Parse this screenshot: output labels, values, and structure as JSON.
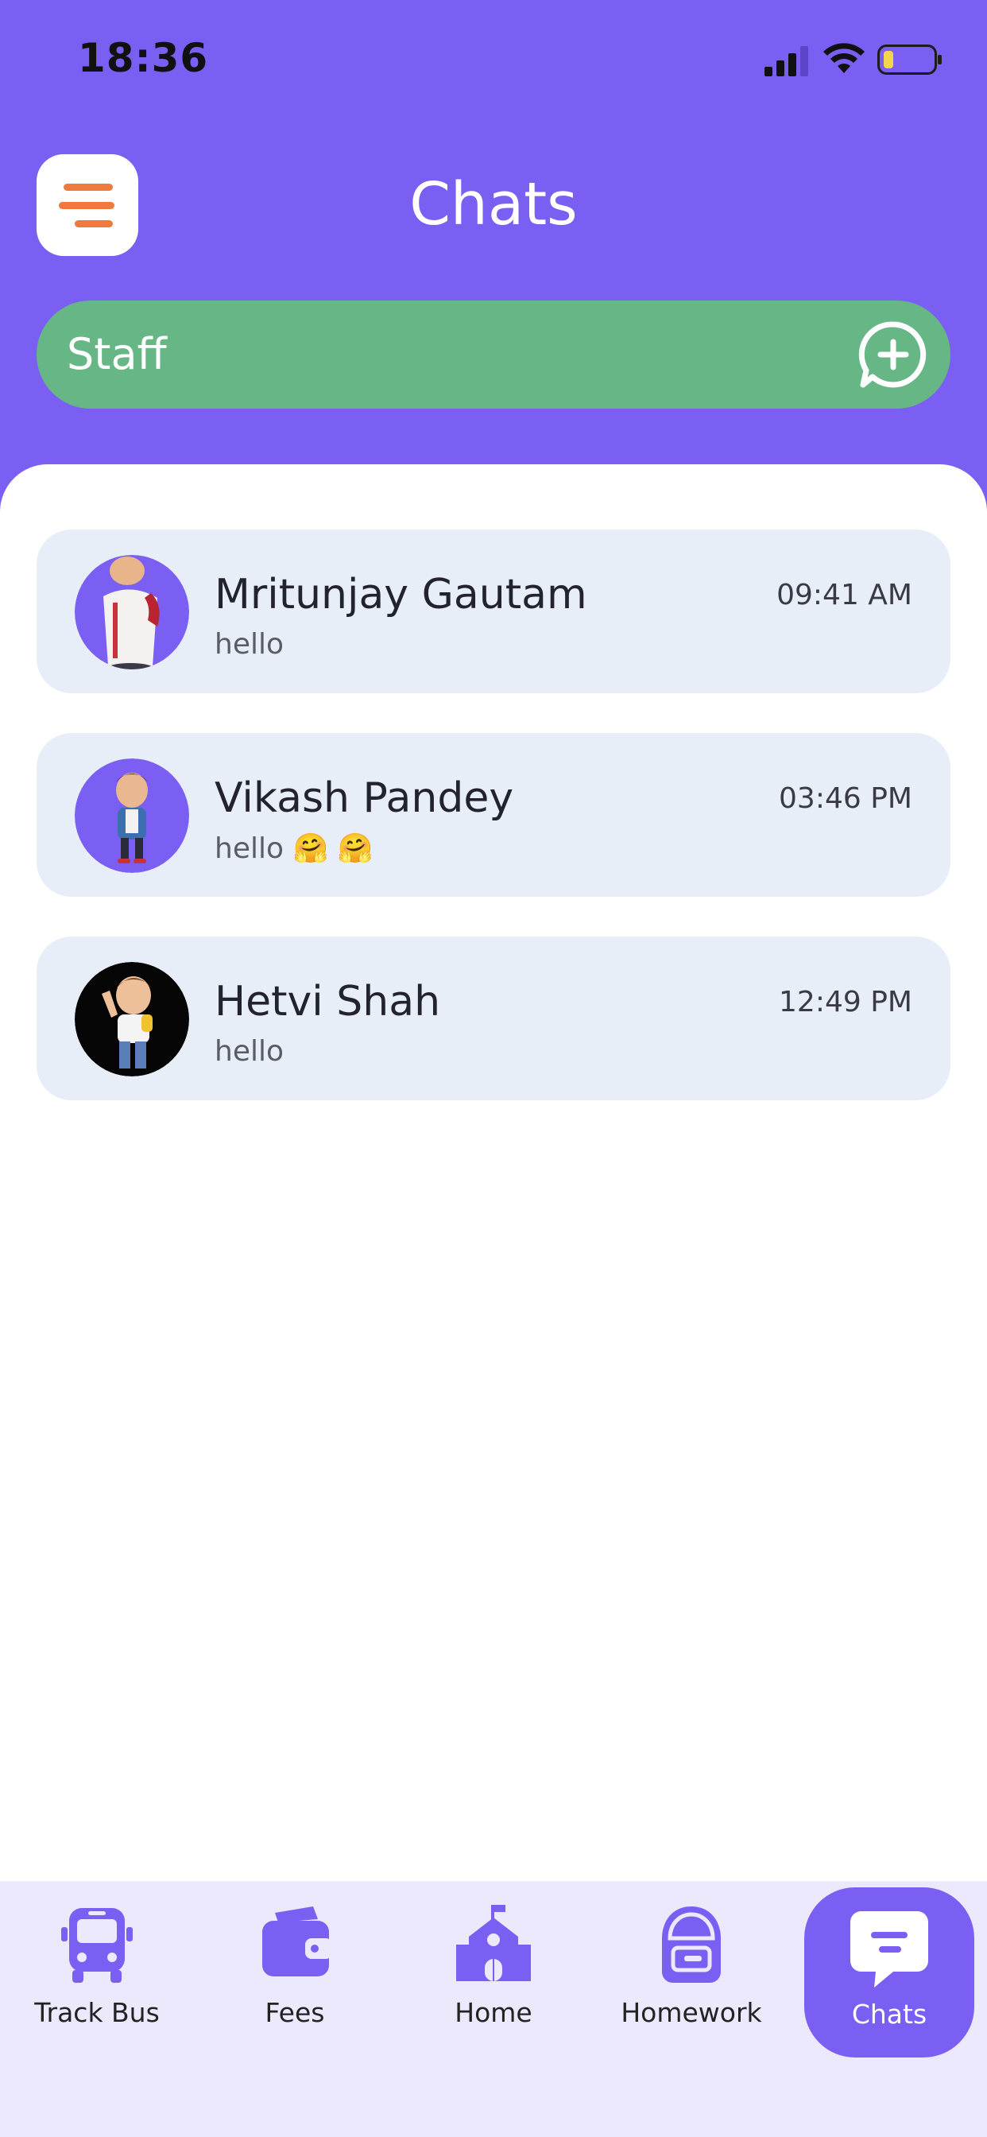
{
  "status_bar": {
    "time": "18:36"
  },
  "header": {
    "title": "Chats"
  },
  "staff_bar": {
    "label": "Staff"
  },
  "chats": [
    {
      "name": "Mritunjay Gautam",
      "message": "hello",
      "time": "09:41 AM"
    },
    {
      "name": "Vikash Pandey",
      "message": "hello 🤗 🤗",
      "time": "03:46 PM"
    },
    {
      "name": "Hetvi Shah",
      "message": "hello",
      "time": "12:49 PM"
    }
  ],
  "bottom_nav": {
    "items": [
      {
        "label": "Track Bus",
        "icon": "bus-icon"
      },
      {
        "label": "Fees",
        "icon": "wallet-icon"
      },
      {
        "label": "Home",
        "icon": "school-icon"
      },
      {
        "label": "Homework",
        "icon": "backpack-icon"
      },
      {
        "label": "Chats",
        "icon": "chat-icon",
        "active": true
      }
    ]
  },
  "colors": {
    "primary": "#7B5FF3",
    "staff_green": "#66B785",
    "menu_orange": "#EE7A3E",
    "chat_card": "#E8EEF8",
    "nav_bg": "#ECE9FC"
  }
}
